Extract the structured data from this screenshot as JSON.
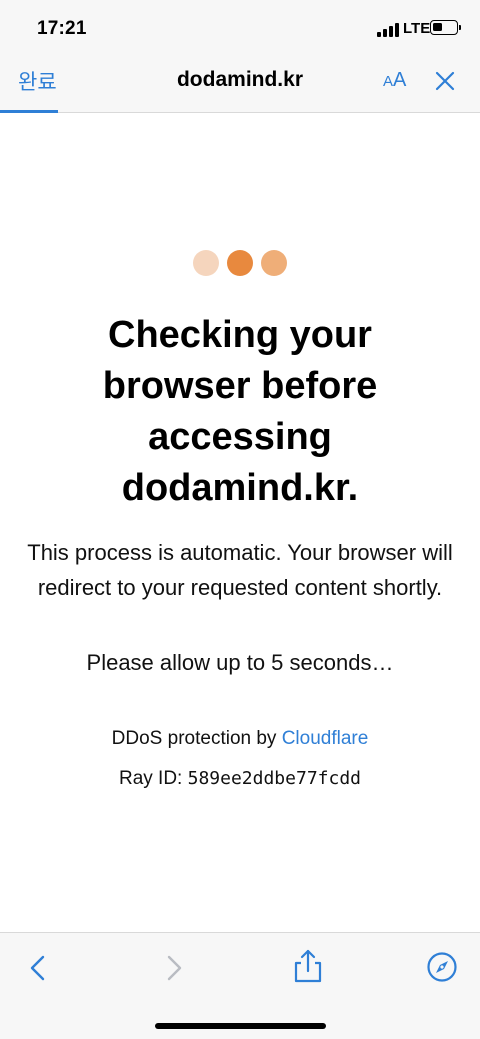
{
  "status_bar": {
    "time": "17:21",
    "network": "LTE",
    "icons": [
      "signal-bars-icon",
      "battery-icon"
    ]
  },
  "nav": {
    "done_label": "완료",
    "title": "dodamind.kr",
    "text_size_small": "A",
    "text_size_large": "A",
    "icons": [
      "close-icon"
    ]
  },
  "page": {
    "heading": "Checking your browser before accessing dodamind.kr.",
    "description": "This process is automatic. Your browser will redirect to your requested content shortly.",
    "allow_text": "Please allow up to 5 seconds…",
    "ddos_prefix": "DDoS protection by ",
    "ddos_link": "Cloudflare",
    "ray_label": "Ray ID: ",
    "ray_id": "589ee2ddbe77fcdd"
  },
  "loader_colors": [
    "#f5d5bd",
    "#e8893e",
    "#efae78"
  ],
  "toolbar": {
    "icons": [
      "back-icon",
      "forward-icon",
      "share-icon",
      "compass-icon"
    ]
  },
  "colors": {
    "accent": "#2f7fd6",
    "bar_background": "#f7f7f7"
  }
}
